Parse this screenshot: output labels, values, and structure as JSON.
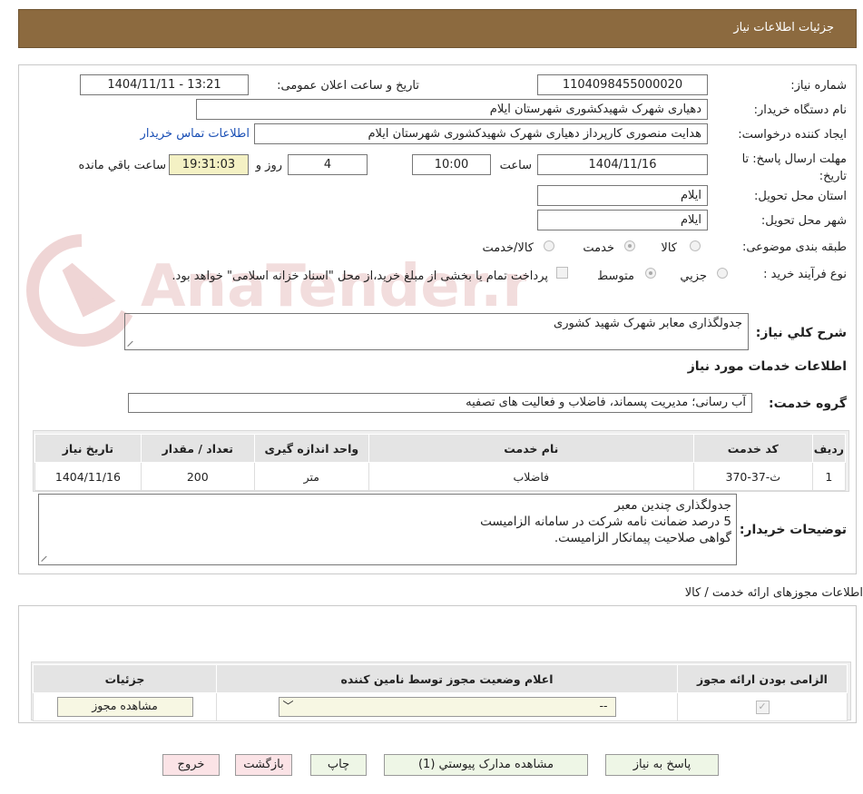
{
  "header": {
    "title": "جزئیات اطلاعات نیاز"
  },
  "form": {
    "need_number_label": "شماره نیاز:",
    "need_number": "1104098455000020",
    "announce_label": "تاریخ و ساعت اعلان عمومی:",
    "announce_value": "1404/11/11 - 13:21",
    "buyer_org_label": "نام دستگاه خریدار:",
    "buyer_org": "دهیاری شهرک شهیدکشوری شهرستان ایلام",
    "requester_label": "ایجاد کننده درخواست:",
    "requester": "هدایت منصوری کارپرداز دهیاری شهرک شهیدکشوری شهرستان ایلام",
    "buyer_contact_link": "اطلاعات تماس خریدار",
    "deadline_label": "مهلت ارسال پاسخ: تا تاریخ:",
    "deadline_date": "1404/11/16",
    "time_label": "ساعت",
    "deadline_time": "10:00",
    "days_value": "4",
    "days_label": "روز و",
    "remaining_time": "19:31:03",
    "remaining_label": "ساعت باقي مانده",
    "province_label": "استان محل تحویل:",
    "province": "ایلام",
    "city_label": "شهر محل تحویل:",
    "city": "ایلام",
    "category_label": "طبقه بندی موضوعی:",
    "category_options": [
      "کالا",
      "خدمت",
      "کالا/خدمت"
    ],
    "category_selected": "خدمت",
    "process_label": "نوع فرآیند خرید :",
    "process_options": [
      "جزیي",
      "متوسط"
    ],
    "process_selected": "متوسط",
    "treasury_note": "پرداخت تمام یا بخشی از مبلغ خرید،از محل \"اسناد خزانه اسلامی\" خواهد بود."
  },
  "watermark": {
    "text": "AnaTender.net",
    "color": "#d9a3a3"
  },
  "description": {
    "label": "شرح کلي نیاز:",
    "value": "جدولگذاری معابر شهرک شهید کشوری"
  },
  "services": {
    "section_title": "اطلاعات خدمات مورد نیاز",
    "group_label": "گروه خدمت:",
    "group_value": "آب رسانی؛ مدیریت پسماند، فاضلاب و فعالیت های تصفیه",
    "columns": [
      "ردیف",
      "کد خدمت",
      "نام خدمت",
      "واحد اندازه گیری",
      "تعداد / مقدار",
      "تاریخ نیاز"
    ],
    "rows": [
      [
        "1",
        "ث-37-370",
        "فاضلاب",
        "متر",
        "200",
        "1404/11/16"
      ]
    ]
  },
  "buyer_notes": {
    "label": "توضیحات خریدار:",
    "lines": [
      "جدولگذاری چندین معبر",
      "5 درصد ضمانت نامه شرکت در سامانه الزامیست",
      "گواهی صلاحیت پیمانکار الزامیست."
    ]
  },
  "permits": {
    "section_title": "اطلاعات مجوزهای ارائه خدمت / کالا",
    "columns": [
      "الزامی بودن ارائه مجوز",
      "اعلام وضعیت مجوز توسط نامین کننده",
      "جزئیات"
    ],
    "select_value": "--",
    "view_button": "مشاهده مجوز"
  },
  "buttons": {
    "reply": "پاسخ به نیاز",
    "attachments": "مشاهده مدارک پیوستي (1)",
    "print": "چاپ",
    "back": "بازگشت",
    "exit": "خروج"
  },
  "colors": {
    "header_bg": "#8c6a3f",
    "link": "#1a4fb5",
    "green_button": "#eef6e6",
    "pink_button": "#fbe3e6",
    "remaining_bg": "#f4f1c4"
  }
}
